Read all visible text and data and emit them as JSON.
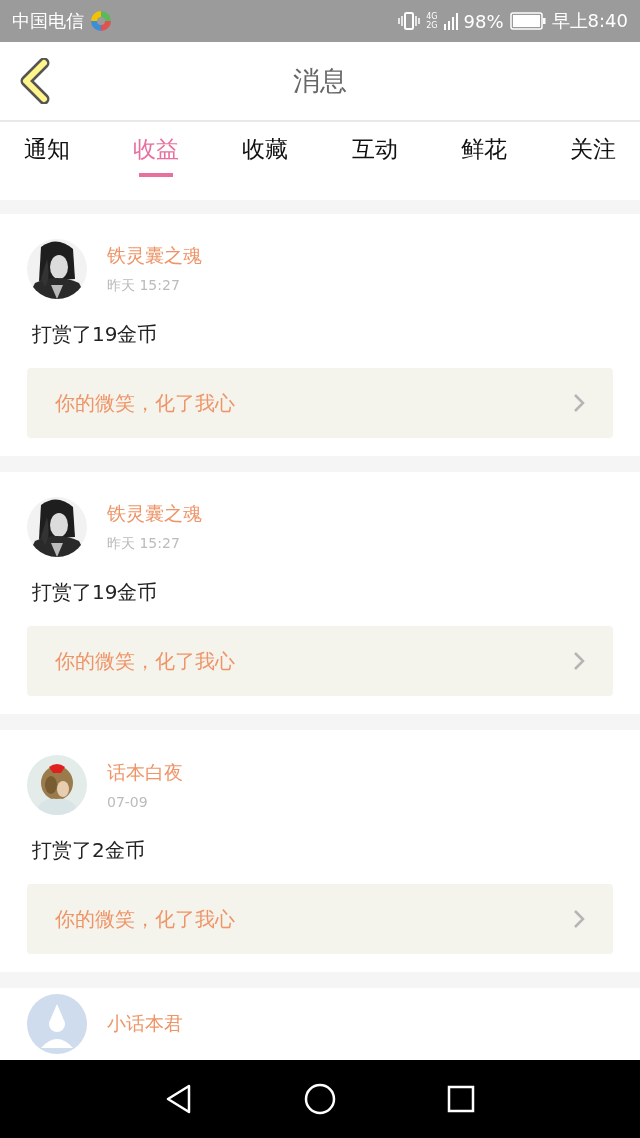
{
  "status_bar": {
    "carrier": "中国电信",
    "network_top": "4G",
    "network_bottom": "2G",
    "battery": "98%",
    "time": "早上8:40"
  },
  "header": {
    "title": "消息"
  },
  "tabs": [
    {
      "label": "通知",
      "selected": false
    },
    {
      "label": "收益",
      "selected": true
    },
    {
      "label": "收藏",
      "selected": false
    },
    {
      "label": "互动",
      "selected": false
    },
    {
      "label": "鲜花",
      "selected": false
    },
    {
      "label": "关注",
      "selected": false
    }
  ],
  "messages": [
    {
      "name": "铁灵囊之魂",
      "time": "昨天 15:27",
      "content": "打赏了19金币",
      "reply": "你的微笑，化了我心"
    },
    {
      "name": "铁灵囊之魂",
      "time": "昨天 15:27",
      "content": "打赏了19金币",
      "reply": "你的微笑，化了我心"
    },
    {
      "name": "话本白夜",
      "time": "07-09",
      "content": "打赏了2金币",
      "reply": "你的微笑，化了我心"
    },
    {
      "avatar": {
        "kind": "default"
      },
      "name": "小话本君"
    }
  ]
}
